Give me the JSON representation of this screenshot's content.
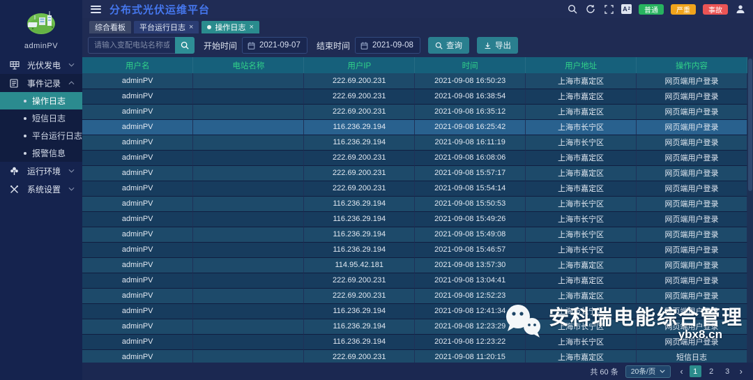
{
  "app": {
    "title": "分布式光伏运维平台",
    "logo_user": "adminPV"
  },
  "topbar": {
    "font_icon_label": "A",
    "badges": [
      {
        "label": "普通",
        "color": "#27b35f"
      },
      {
        "label": "严重",
        "color": "#f0a41c"
      },
      {
        "label": "事故",
        "color": "#ea5455"
      }
    ]
  },
  "tabs": [
    {
      "label": "综合看板",
      "closable": false,
      "active": false
    },
    {
      "label": "平台运行日志",
      "closable": true,
      "active": false
    },
    {
      "label": "操作日志",
      "closable": true,
      "active": true
    }
  ],
  "sidebar": {
    "items": [
      {
        "label": "光伏发电",
        "icon": "pv-icon",
        "state": "collapsed"
      },
      {
        "label": "事件记录",
        "icon": "records-icon",
        "state": "expanded",
        "children": [
          "操作日志",
          "短信日志",
          "平台运行日志",
          "报警信息"
        ],
        "active_child": "操作日志"
      },
      {
        "label": "运行环境",
        "icon": "env-icon",
        "state": "collapsed"
      },
      {
        "label": "系统设置",
        "icon": "settings-icon",
        "state": "collapsed"
      }
    ]
  },
  "filters": {
    "search_placeholder": "请输入变配电站名称或用户",
    "start_label": "开始时间",
    "start_value": "2021-09-07",
    "end_label": "结束时间",
    "end_value": "2021-09-08",
    "query_label": "查询",
    "export_label": "导出"
  },
  "table": {
    "columns": [
      "用户名",
      "电站名称",
      "用户IP",
      "时间",
      "用户地址",
      "操作内容"
    ],
    "highlighted_row": 3,
    "rows": [
      {
        "user": "adminPV",
        "station": "",
        "ip": "222.69.200.231",
        "time": "2021-09-08 16:50:23",
        "address": "上海市嘉定区",
        "action": "网页端用户登录"
      },
      {
        "user": "adminPV",
        "station": "",
        "ip": "222.69.200.231",
        "time": "2021-09-08 16:38:54",
        "address": "上海市嘉定区",
        "action": "网页端用户登录"
      },
      {
        "user": "adminPV",
        "station": "",
        "ip": "222.69.200.231",
        "time": "2021-09-08 16:35:12",
        "address": "上海市嘉定区",
        "action": "网页端用户登录"
      },
      {
        "user": "adminPV",
        "station": "",
        "ip": "116.236.29.194",
        "time": "2021-09-08 16:25:42",
        "address": "上海市长宁区",
        "action": "网页端用户登录"
      },
      {
        "user": "adminPV",
        "station": "",
        "ip": "116.236.29.194",
        "time": "2021-09-08 16:11:19",
        "address": "上海市长宁区",
        "action": "网页端用户登录"
      },
      {
        "user": "adminPV",
        "station": "",
        "ip": "222.69.200.231",
        "time": "2021-09-08 16:08:06",
        "address": "上海市嘉定区",
        "action": "网页端用户登录"
      },
      {
        "user": "adminPV",
        "station": "",
        "ip": "222.69.200.231",
        "time": "2021-09-08 15:57:17",
        "address": "上海市嘉定区",
        "action": "网页端用户登录"
      },
      {
        "user": "adminPV",
        "station": "",
        "ip": "222.69.200.231",
        "time": "2021-09-08 15:54:14",
        "address": "上海市嘉定区",
        "action": "网页端用户登录"
      },
      {
        "user": "adminPV",
        "station": "",
        "ip": "116.236.29.194",
        "time": "2021-09-08 15:50:53",
        "address": "上海市长宁区",
        "action": "网页端用户登录"
      },
      {
        "user": "adminPV",
        "station": "",
        "ip": "116.236.29.194",
        "time": "2021-09-08 15:49:26",
        "address": "上海市长宁区",
        "action": "网页端用户登录"
      },
      {
        "user": "adminPV",
        "station": "",
        "ip": "116.236.29.194",
        "time": "2021-09-08 15:49:08",
        "address": "上海市长宁区",
        "action": "网页端用户登录"
      },
      {
        "user": "adminPV",
        "station": "",
        "ip": "116.236.29.194",
        "time": "2021-09-08 15:46:57",
        "address": "上海市长宁区",
        "action": "网页端用户登录"
      },
      {
        "user": "adminPV",
        "station": "",
        "ip": "114.95.42.181",
        "time": "2021-09-08 13:57:30",
        "address": "上海市嘉定区",
        "action": "网页端用户登录"
      },
      {
        "user": "adminPV",
        "station": "",
        "ip": "222.69.200.231",
        "time": "2021-09-08 13:04:41",
        "address": "上海市嘉定区",
        "action": "网页端用户登录"
      },
      {
        "user": "adminPV",
        "station": "",
        "ip": "222.69.200.231",
        "time": "2021-09-08 12:52:23",
        "address": "上海市嘉定区",
        "action": "网页端用户登录"
      },
      {
        "user": "adminPV",
        "station": "",
        "ip": "116.236.29.194",
        "time": "2021-09-08 12:41:34",
        "address": "上海市长宁区",
        "action": "网页端用户登录"
      },
      {
        "user": "adminPV",
        "station": "",
        "ip": "116.236.29.194",
        "time": "2021-09-08 12:23:29",
        "address": "上海市长宁区",
        "action": "网页端用户登录"
      },
      {
        "user": "adminPV",
        "station": "",
        "ip": "116.236.29.194",
        "time": "2021-09-08 12:23:22",
        "address": "上海市长宁区",
        "action": "网页端用户登录"
      },
      {
        "user": "adminPV",
        "station": "",
        "ip": "222.69.200.231",
        "time": "2021-09-08 11:20:15",
        "address": "上海市嘉定区",
        "action": "短信日志"
      }
    ]
  },
  "pagination": {
    "total_label": "共 60 条",
    "page_size_label": "20条/页",
    "pages": [
      "1",
      "2",
      "3"
    ],
    "current_page": "1"
  },
  "watermark": {
    "text": "安科瑞电能综合管理",
    "url": "ybx8.cn"
  },
  "glyphs": {
    "close": "×",
    "prev": "‹",
    "next": "›"
  },
  "colors": {
    "accent_teal": "#2b8b8f",
    "title_blue": "#4577ee",
    "table_header_bg": "#16607b",
    "table_header_text": "#31d189",
    "row_odd": "#1d4a6a",
    "row_even": "#173c5e",
    "row_highlight": "#29618e",
    "sidebar_bg": "#15234e",
    "topbar_bg": "#202c55"
  }
}
